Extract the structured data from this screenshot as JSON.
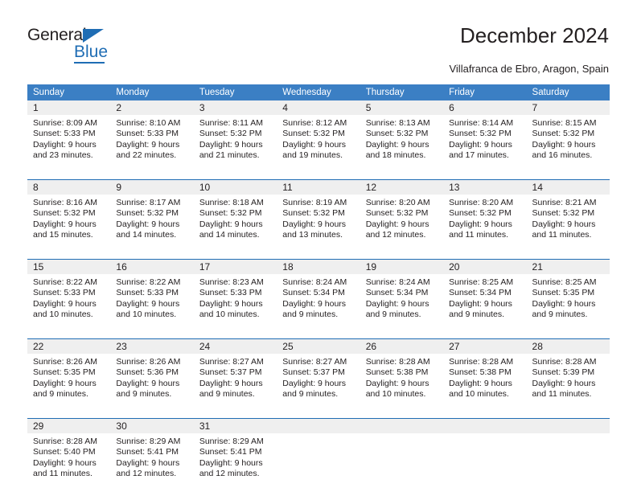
{
  "brand": {
    "name_part1": "General",
    "name_part2": "Blue",
    "triangle_icon": "triangle-icon",
    "accent_color": "#1f6db4"
  },
  "header": {
    "title": "December 2024",
    "subtitle": "Villafranca de Ebro, Aragon, Spain"
  },
  "calendar": {
    "header_bg": "#3b7fc4",
    "daynum_bg": "#efefef",
    "separator_color": "#1f6db4",
    "weekday_headers": [
      "Sunday",
      "Monday",
      "Tuesday",
      "Wednesday",
      "Thursday",
      "Friday",
      "Saturday"
    ],
    "weeks": [
      [
        {
          "day": "1",
          "sunrise": "Sunrise: 8:09 AM",
          "sunset": "Sunset: 5:33 PM",
          "daylight_1": "Daylight: 9 hours",
          "daylight_2": "and 23 minutes."
        },
        {
          "day": "2",
          "sunrise": "Sunrise: 8:10 AM",
          "sunset": "Sunset: 5:33 PM",
          "daylight_1": "Daylight: 9 hours",
          "daylight_2": "and 22 minutes."
        },
        {
          "day": "3",
          "sunrise": "Sunrise: 8:11 AM",
          "sunset": "Sunset: 5:32 PM",
          "daylight_1": "Daylight: 9 hours",
          "daylight_2": "and 21 minutes."
        },
        {
          "day": "4",
          "sunrise": "Sunrise: 8:12 AM",
          "sunset": "Sunset: 5:32 PM",
          "daylight_1": "Daylight: 9 hours",
          "daylight_2": "and 19 minutes."
        },
        {
          "day": "5",
          "sunrise": "Sunrise: 8:13 AM",
          "sunset": "Sunset: 5:32 PM",
          "daylight_1": "Daylight: 9 hours",
          "daylight_2": "and 18 minutes."
        },
        {
          "day": "6",
          "sunrise": "Sunrise: 8:14 AM",
          "sunset": "Sunset: 5:32 PM",
          "daylight_1": "Daylight: 9 hours",
          "daylight_2": "and 17 minutes."
        },
        {
          "day": "7",
          "sunrise": "Sunrise: 8:15 AM",
          "sunset": "Sunset: 5:32 PM",
          "daylight_1": "Daylight: 9 hours",
          "daylight_2": "and 16 minutes."
        }
      ],
      [
        {
          "day": "8",
          "sunrise": "Sunrise: 8:16 AM",
          "sunset": "Sunset: 5:32 PM",
          "daylight_1": "Daylight: 9 hours",
          "daylight_2": "and 15 minutes."
        },
        {
          "day": "9",
          "sunrise": "Sunrise: 8:17 AM",
          "sunset": "Sunset: 5:32 PM",
          "daylight_1": "Daylight: 9 hours",
          "daylight_2": "and 14 minutes."
        },
        {
          "day": "10",
          "sunrise": "Sunrise: 8:18 AM",
          "sunset": "Sunset: 5:32 PM",
          "daylight_1": "Daylight: 9 hours",
          "daylight_2": "and 14 minutes."
        },
        {
          "day": "11",
          "sunrise": "Sunrise: 8:19 AM",
          "sunset": "Sunset: 5:32 PM",
          "daylight_1": "Daylight: 9 hours",
          "daylight_2": "and 13 minutes."
        },
        {
          "day": "12",
          "sunrise": "Sunrise: 8:20 AM",
          "sunset": "Sunset: 5:32 PM",
          "daylight_1": "Daylight: 9 hours",
          "daylight_2": "and 12 minutes."
        },
        {
          "day": "13",
          "sunrise": "Sunrise: 8:20 AM",
          "sunset": "Sunset: 5:32 PM",
          "daylight_1": "Daylight: 9 hours",
          "daylight_2": "and 11 minutes."
        },
        {
          "day": "14",
          "sunrise": "Sunrise: 8:21 AM",
          "sunset": "Sunset: 5:32 PM",
          "daylight_1": "Daylight: 9 hours",
          "daylight_2": "and 11 minutes."
        }
      ],
      [
        {
          "day": "15",
          "sunrise": "Sunrise: 8:22 AM",
          "sunset": "Sunset: 5:33 PM",
          "daylight_1": "Daylight: 9 hours",
          "daylight_2": "and 10 minutes."
        },
        {
          "day": "16",
          "sunrise": "Sunrise: 8:22 AM",
          "sunset": "Sunset: 5:33 PM",
          "daylight_1": "Daylight: 9 hours",
          "daylight_2": "and 10 minutes."
        },
        {
          "day": "17",
          "sunrise": "Sunrise: 8:23 AM",
          "sunset": "Sunset: 5:33 PM",
          "daylight_1": "Daylight: 9 hours",
          "daylight_2": "and 10 minutes."
        },
        {
          "day": "18",
          "sunrise": "Sunrise: 8:24 AM",
          "sunset": "Sunset: 5:34 PM",
          "daylight_1": "Daylight: 9 hours",
          "daylight_2": "and 9 minutes."
        },
        {
          "day": "19",
          "sunrise": "Sunrise: 8:24 AM",
          "sunset": "Sunset: 5:34 PM",
          "daylight_1": "Daylight: 9 hours",
          "daylight_2": "and 9 minutes."
        },
        {
          "day": "20",
          "sunrise": "Sunrise: 8:25 AM",
          "sunset": "Sunset: 5:34 PM",
          "daylight_1": "Daylight: 9 hours",
          "daylight_2": "and 9 minutes."
        },
        {
          "day": "21",
          "sunrise": "Sunrise: 8:25 AM",
          "sunset": "Sunset: 5:35 PM",
          "daylight_1": "Daylight: 9 hours",
          "daylight_2": "and 9 minutes."
        }
      ],
      [
        {
          "day": "22",
          "sunrise": "Sunrise: 8:26 AM",
          "sunset": "Sunset: 5:35 PM",
          "daylight_1": "Daylight: 9 hours",
          "daylight_2": "and 9 minutes."
        },
        {
          "day": "23",
          "sunrise": "Sunrise: 8:26 AM",
          "sunset": "Sunset: 5:36 PM",
          "daylight_1": "Daylight: 9 hours",
          "daylight_2": "and 9 minutes."
        },
        {
          "day": "24",
          "sunrise": "Sunrise: 8:27 AM",
          "sunset": "Sunset: 5:37 PM",
          "daylight_1": "Daylight: 9 hours",
          "daylight_2": "and 9 minutes."
        },
        {
          "day": "25",
          "sunrise": "Sunrise: 8:27 AM",
          "sunset": "Sunset: 5:37 PM",
          "daylight_1": "Daylight: 9 hours",
          "daylight_2": "and 9 minutes."
        },
        {
          "day": "26",
          "sunrise": "Sunrise: 8:28 AM",
          "sunset": "Sunset: 5:38 PM",
          "daylight_1": "Daylight: 9 hours",
          "daylight_2": "and 10 minutes."
        },
        {
          "day": "27",
          "sunrise": "Sunrise: 8:28 AM",
          "sunset": "Sunset: 5:38 PM",
          "daylight_1": "Daylight: 9 hours",
          "daylight_2": "and 10 minutes."
        },
        {
          "day": "28",
          "sunrise": "Sunrise: 8:28 AM",
          "sunset": "Sunset: 5:39 PM",
          "daylight_1": "Daylight: 9 hours",
          "daylight_2": "and 11 minutes."
        }
      ],
      [
        {
          "day": "29",
          "sunrise": "Sunrise: 8:28 AM",
          "sunset": "Sunset: 5:40 PM",
          "daylight_1": "Daylight: 9 hours",
          "daylight_2": "and 11 minutes."
        },
        {
          "day": "30",
          "sunrise": "Sunrise: 8:29 AM",
          "sunset": "Sunset: 5:41 PM",
          "daylight_1": "Daylight: 9 hours",
          "daylight_2": "and 12 minutes."
        },
        {
          "day": "31",
          "sunrise": "Sunrise: 8:29 AM",
          "sunset": "Sunset: 5:41 PM",
          "daylight_1": "Daylight: 9 hours",
          "daylight_2": "and 12 minutes."
        },
        {
          "day": "",
          "sunrise": "",
          "sunset": "",
          "daylight_1": "",
          "daylight_2": ""
        },
        {
          "day": "",
          "sunrise": "",
          "sunset": "",
          "daylight_1": "",
          "daylight_2": ""
        },
        {
          "day": "",
          "sunrise": "",
          "sunset": "",
          "daylight_1": "",
          "daylight_2": ""
        },
        {
          "day": "",
          "sunrise": "",
          "sunset": "",
          "daylight_1": "",
          "daylight_2": ""
        }
      ]
    ]
  }
}
